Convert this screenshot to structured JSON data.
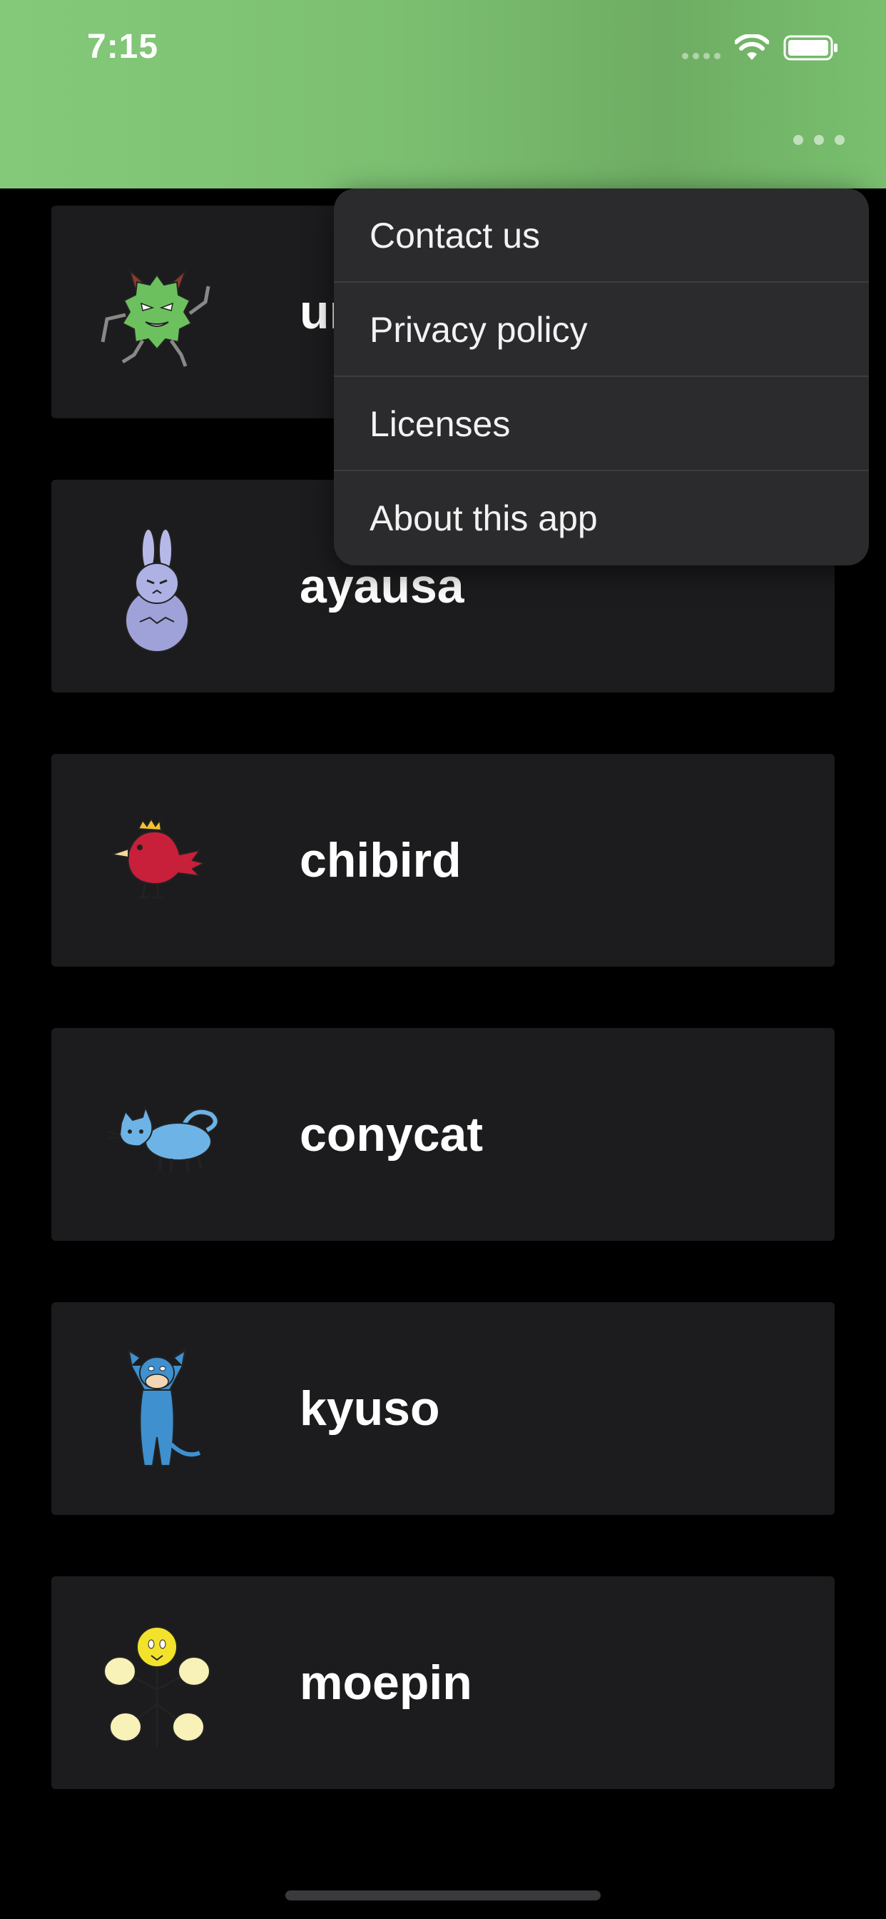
{
  "status_bar": {
    "time": "7:15"
  },
  "colors": {
    "header_green": "#7cbf71",
    "card_background": "#1c1c1e",
    "menu_background": "#2b2b2d"
  },
  "header": {
    "more_icon": "ellipsis-icon"
  },
  "menu": {
    "items": [
      {
        "label": "Contact us"
      },
      {
        "label": "Privacy policy"
      },
      {
        "label": "Licenses"
      },
      {
        "label": "About this app"
      }
    ]
  },
  "characters": [
    {
      "name": "uni",
      "icon": "green-monster-icon"
    },
    {
      "name": "ayausa",
      "icon": "purple-rabbit-icon"
    },
    {
      "name": "chibird",
      "icon": "red-bird-icon"
    },
    {
      "name": "conycat",
      "icon": "blue-cat-icon"
    },
    {
      "name": "kyuso",
      "icon": "blue-mouse-icon"
    },
    {
      "name": "moepin",
      "icon": "yellow-flower-icon"
    }
  ]
}
